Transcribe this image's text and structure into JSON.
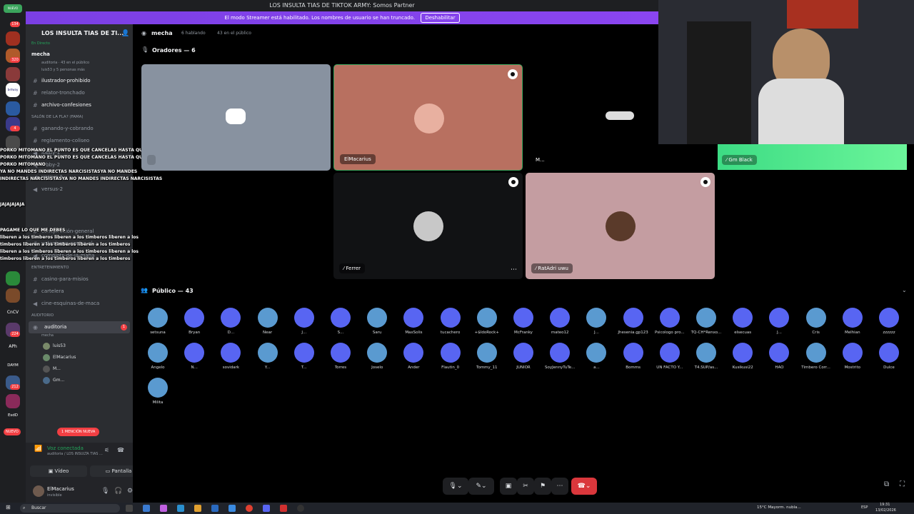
{
  "window": {
    "title": "LOS INSULTA TIAS DE TIKTOK ARMY: Somos Partner"
  },
  "streamer_banner": {
    "text": "El modo Streamer está habilitado. Los nombres de usuario se han truncado.",
    "button": "Deshabilitar"
  },
  "rail": {
    "items": [
      {
        "label": "NUEVO",
        "badge": "134"
      },
      {
        "label": "",
        "badge": ""
      },
      {
        "label": "",
        "badge": "320"
      },
      {
        "label": "",
        "badge": ""
      },
      {
        "label": "betway esports",
        "badge": ""
      },
      {
        "label": "",
        "badge": ""
      },
      {
        "label": "",
        "badge": "4"
      },
      {
        "label": "",
        "badge": ""
      },
      {
        "label": "",
        "badge": ""
      },
      {
        "label": "CnCV",
        "badge": ""
      },
      {
        "label": "",
        "badge": "224"
      },
      {
        "label": "APh",
        "badge": ""
      },
      {
        "label": "DAYM",
        "badge": ""
      },
      {
        "label": "",
        "badge": "212"
      },
      {
        "label": "EsdD",
        "badge": ""
      },
      {
        "label": "NUEVO",
        "badge": ""
      }
    ]
  },
  "sidebar": {
    "guild_name": "LOS INSULTA TIAS DE TI...",
    "live_label": "En Directo",
    "live_channel": "mecha",
    "live_sub1": "auditoria · 43 en el público",
    "live_sub2": "luis53 y 5 personas más",
    "channels_top": [
      {
        "name": "ilustrador-prohibido",
        "bright": true
      },
      {
        "name": "relator-tronchado",
        "bright": false
      },
      {
        "name": "archivo-confesiones",
        "bright": true
      }
    ],
    "category_salon": "SALÓN DE LA FLA? (FAMA)",
    "channels_salon": [
      {
        "name": "ganando-y-cobrando"
      },
      {
        "name": "reglamento-coliseo"
      },
      {
        "name": "lobby-1"
      },
      {
        "name": "lobby-2"
      },
      {
        "name": "versus-1"
      },
      {
        "name": "versus-2"
      }
    ],
    "channels_mid": [
      {
        "name": "conspiración-general"
      },
      {
        "name": "votaciones-contra-el-..."
      },
      {
        "name": "complots-de-la-mafia"
      }
    ],
    "category_entretenimiento": "ENTRETENIMIENTO",
    "channels_ent": [
      {
        "name": "casino-para-misios"
      },
      {
        "name": "cartelera"
      },
      {
        "name": "cine-esquinas-de-maca"
      }
    ],
    "category_auditorio": "AUDITORIO",
    "auditorio_channel": "auditoria",
    "auditorio_sub": "mecha",
    "auditorio_badge": "1",
    "voice_members": [
      "luis53",
      "ElMacarius",
      "M...",
      "Gm..."
    ],
    "mention_badge": "1 MENCIÓN NUEVA",
    "voice_connected": "Voz conectada",
    "voice_sub": "auditoria / LOS INSULTA TIAS ...",
    "video_btn": "Vídeo",
    "screen_btn": "Pantalla",
    "user_name": "ElMacarius",
    "user_status": "invisible"
  },
  "chat_overlay": [
    "PORKO MITOMANO EL PUNTO ES QUE CANCELAS HASTA QUE GANAS DE",
    "PORKO MITOMANO EL PUNTO ES QUE CANCELAS HASTA QUE GANAS DE",
    "PORKO MITOMANO",
    "YA NO MANDES INDIRECTAS NARCISISTASYA NO MANDES",
    "INDIRECTAS NARCISISTASYA NO MANDES INDIRECTAS NARCISISTAS",
    "JAJAJAJAJA",
    "PAGAME LO QUE ME DEBES",
    "liberen a los timberos  liberen a los timberos  liberen a los",
    "timberos  liberen a los timberos  liberen a los timberos",
    "liberen a los timberos  liberen a los timberos  liberen a los",
    "timberos  liberen a los timberos  liberen a los timberos"
  ],
  "stage": {
    "channel": "mecha",
    "speaking": "6 hablando",
    "audience_count": "43 en el público",
    "speakers_label": "Oradores — 6",
    "public_label": "Público — 43",
    "tiles": [
      {
        "name": ""
      },
      {
        "name": "ElMacarius"
      },
      {
        "name": "M..."
      },
      {
        "name": "Ferrer"
      },
      {
        "name": "RatAdri uwu"
      }
    ],
    "webcam_name": "Gm Black"
  },
  "audience": [
    "setsuna",
    "Bryan",
    "D...",
    "Near",
    "J...",
    "S...",
    "Saru",
    "MaxSolis",
    "tucachero",
    "+$IdoRock+",
    "McFranky",
    "mateo12",
    "J...",
    "Jhesenia.gp123",
    "Psicologo pro...",
    "TQ-CH*Renxo...",
    "elsecuas",
    "J...",
    "Cris",
    "Melhian",
    "zzzzzz",
    "Angelo",
    "N...",
    "sovidark",
    "Y...",
    "T...",
    "Torres",
    "Joselo",
    "Ander",
    "Flautin_0",
    "Tommy_11",
    "JUNIOR",
    "SoyJennyTuTe...",
    "a...",
    "Bomms",
    "UN FACTO Y...",
    "T4.SUP/as...",
    "Kusikusi22",
    "HAO",
    "Timbero Corr...",
    "Mostrito",
    "Dulce",
    "Milita"
  ],
  "taskbar": {
    "search": "Buscar",
    "weather": "15°C  Mayorm. nubla...",
    "lang": "ESP",
    "time": "19:31",
    "date": "13/02/2026"
  },
  "colors": {
    "blurple": "#5865f2",
    "green": "#57f287",
    "red": "#da373c",
    "sidebar": "#2b2d31"
  }
}
